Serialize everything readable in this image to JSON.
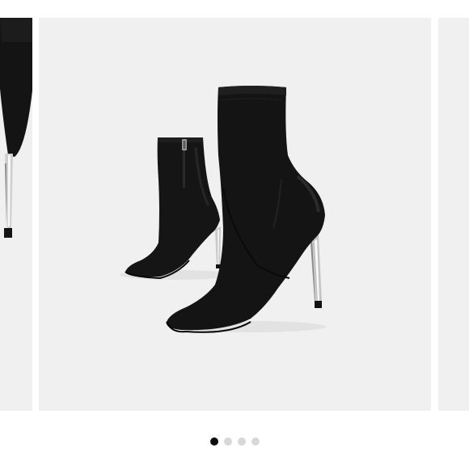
{
  "carousel": {
    "slide_count": 4,
    "active_index": 0,
    "main_image": "black-sock-ankle-boots-silver-stiletto-image",
    "prev_image": "black-boot-partial-image",
    "next_image": "empty-slide-image"
  },
  "colors": {
    "page_background": "#ffffff",
    "slide_background": "#f0f0f0",
    "boot_fabric": "#141414",
    "heel_metal": "#cfcfcf",
    "dot_active": "#0c0c0c",
    "dot_inactive": "#d8d8d8"
  }
}
